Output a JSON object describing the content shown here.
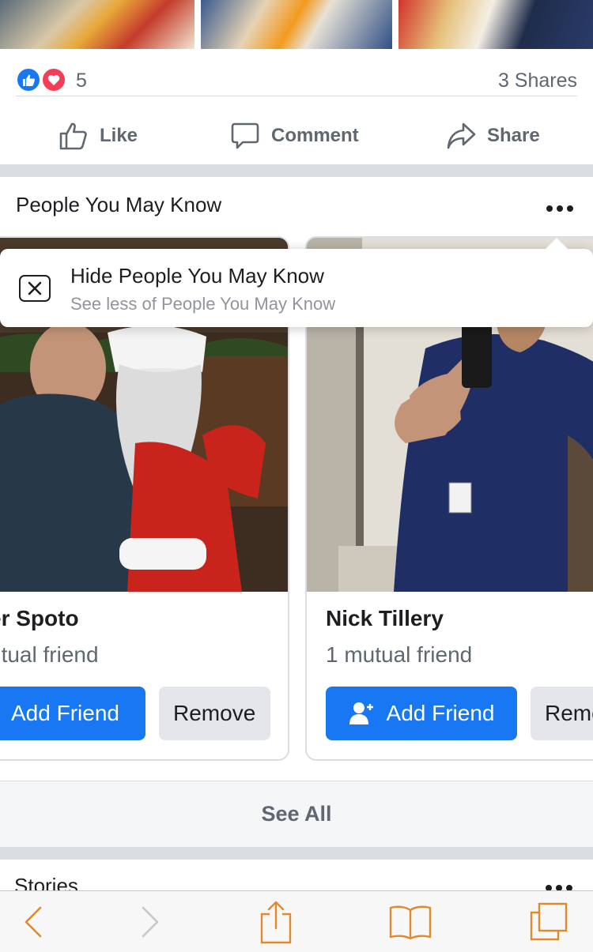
{
  "post": {
    "reaction_count": "5",
    "shares": "3 Shares",
    "actions": {
      "like": "Like",
      "comment": "Comment",
      "share": "Share"
    },
    "colors": {
      "like_blue": "#1877f2",
      "love_red": "#f33e58"
    }
  },
  "pymk": {
    "title": "People You May Know",
    "menu": {
      "hide_title": "Hide People You May Know",
      "hide_subtitle": "See less of People You May Know"
    },
    "people": [
      {
        "name": "er Spoto",
        "mutual": "utual friend",
        "add_label": "Add Friend",
        "remove_label": "Remove"
      },
      {
        "name": "Nick Tillery",
        "mutual": "1 mutual friend",
        "add_label": "Add Friend",
        "remove_label": "Remove"
      }
    ],
    "see_all": "See All"
  },
  "stories": {
    "title": "Stories"
  },
  "browser_toolbar": {
    "icons": [
      "back-icon",
      "forward-icon",
      "share-icon",
      "bookmarks-icon",
      "tabs-icon"
    ],
    "accent": "#e08a2c"
  }
}
